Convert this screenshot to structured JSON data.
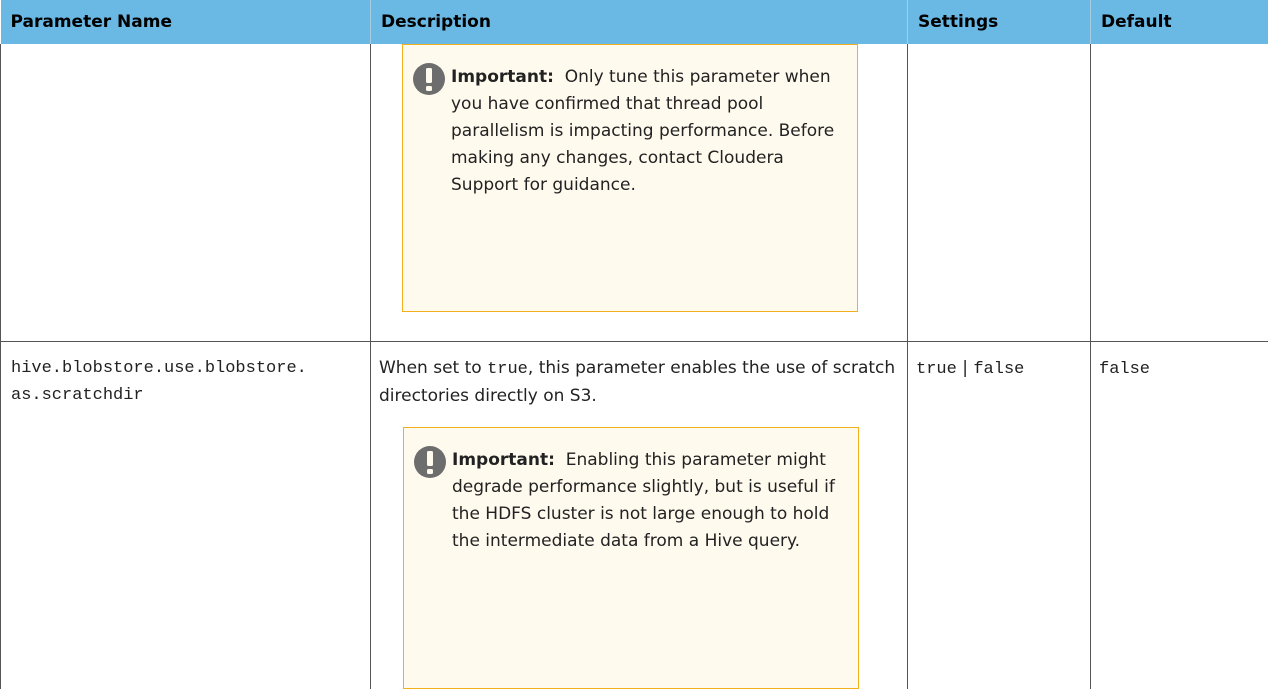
{
  "table": {
    "headers": [
      "Parameter Name",
      "Description",
      "Settings",
      "Default"
    ],
    "row1": {
      "note": {
        "label": "Important:",
        "text": "Only tune this parameter when you have confirmed that thread pool parallelism is impacting performance. Before making any changes, contact Cloudera Support for guidance."
      }
    },
    "row2": {
      "param_line1": "hive.blobstore.use.blobstore.",
      "param_line2": "as.scratchdir",
      "desc_before": "When set to ",
      "desc_code": "true",
      "desc_after": ", this parameter enables the use of scratch directories directly on S3.",
      "settings_true": "true",
      "settings_sep": "|",
      "settings_false": "false",
      "default": "false",
      "note": {
        "label": "Important:",
        "text": "Enabling this parameter might degrade performance slightly, but is useful if the HDFS cluster is not large enough to hold the intermediate data from a Hive query."
      }
    }
  },
  "colors": {
    "header_bg": "#6ab8e4",
    "note_bg": "#fffaee",
    "note_border": "#f2b01e",
    "icon": "#6d6d6d"
  },
  "icons": {
    "note_icon": "exclamation-icon"
  }
}
